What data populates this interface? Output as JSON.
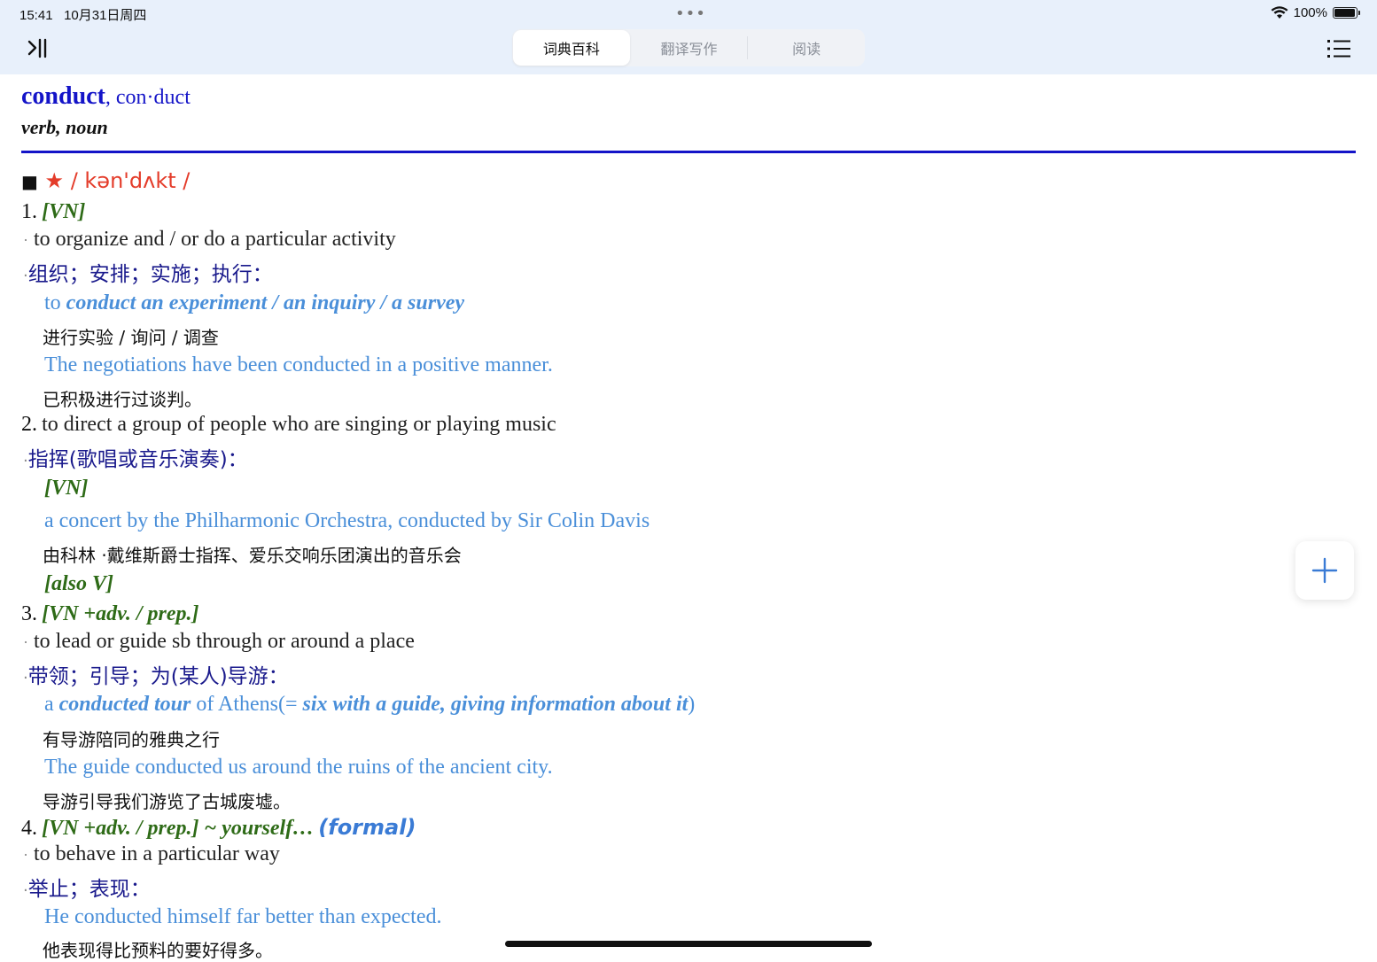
{
  "status": {
    "time": "15:41",
    "date": "10月31日周四",
    "dots": "•••",
    "battery": "100%"
  },
  "tabs": [
    {
      "label": "词典百科",
      "active": true
    },
    {
      "label": "翻译写作",
      "active": false
    },
    {
      "label": "阅读",
      "active": false
    }
  ],
  "entry": {
    "headword": "conduct",
    "comma": ", ",
    "alt_headword": "con·duct",
    "pos": "verb, noun",
    "pron_square": "■",
    "pron_star": "★",
    "pron_ipa": " / kən'dʌkt / "
  },
  "senses": {
    "s1_num": "1.",
    "s1_gram": "[VN]",
    "s1_def": "to organize and / or do a particular activity",
    "s1_zh": "组织；安排；实施；执行：",
    "s1_ex1_pre": "to ",
    "s1_ex1_bold": "conduct an experiment / an inquiry / a survey",
    "s1_ex1_zh": "进行实验 / 询问 / 调查",
    "s1_ex2": "The negotiations have been conducted in a positive manner.",
    "s1_ex2_zh": "已积极进行过谈判。",
    "s2_num": "2.",
    "s2_def": "to direct a group of people who are singing or playing music",
    "s2_zh": "指挥(歌唱或音乐演奏)：",
    "s2_gram": "[VN]",
    "s2_ex1": "a concert by the Philharmonic Orchestra, conducted by Sir Colin Davis",
    "s2_ex1_zh": "由科林 ·戴维斯爵士指挥、爱乐交响乐团演出的音乐会",
    "s2_gram2": "[also V]",
    "s3_num": "3.",
    "s3_gram": "[VN +adv. / prep.]",
    "s3_def": "to lead or guide sb through or around a place",
    "s3_zh": "带领；引导；为(某人)导游：",
    "s3_ex1_a": "a ",
    "s3_ex1_b": "conducted tour",
    "s3_ex1_c": " of Athens(= ",
    "s3_ex1_d": "six with a guide, giving information about it",
    "s3_ex1_e": ")",
    "s3_ex1_zh": "有导游陪同的雅典之行",
    "s3_ex2": "The guide conducted us around the ruins of the ancient city.",
    "s3_ex2_zh": "导游引导我们游览了古城废墟。",
    "s4_num": "4.",
    "s4_gram": "[VN +adv. / prep.] ~ yourself…",
    "s4_formal": "(formal)",
    "s4_def": "to behave in a particular way",
    "s4_zh": "举止；表现：",
    "s4_ex1": "He conducted himself far better than expected.",
    "s4_ex1_zh": "他表现得比预料的要好得多。"
  },
  "bullet": "·",
  "colors": {
    "headword": "#1414c8",
    "grammar": "#2e6b17",
    "example": "#4a8fd9",
    "ipa": "#e43c2a",
    "topbar": "#e8f0fb"
  }
}
